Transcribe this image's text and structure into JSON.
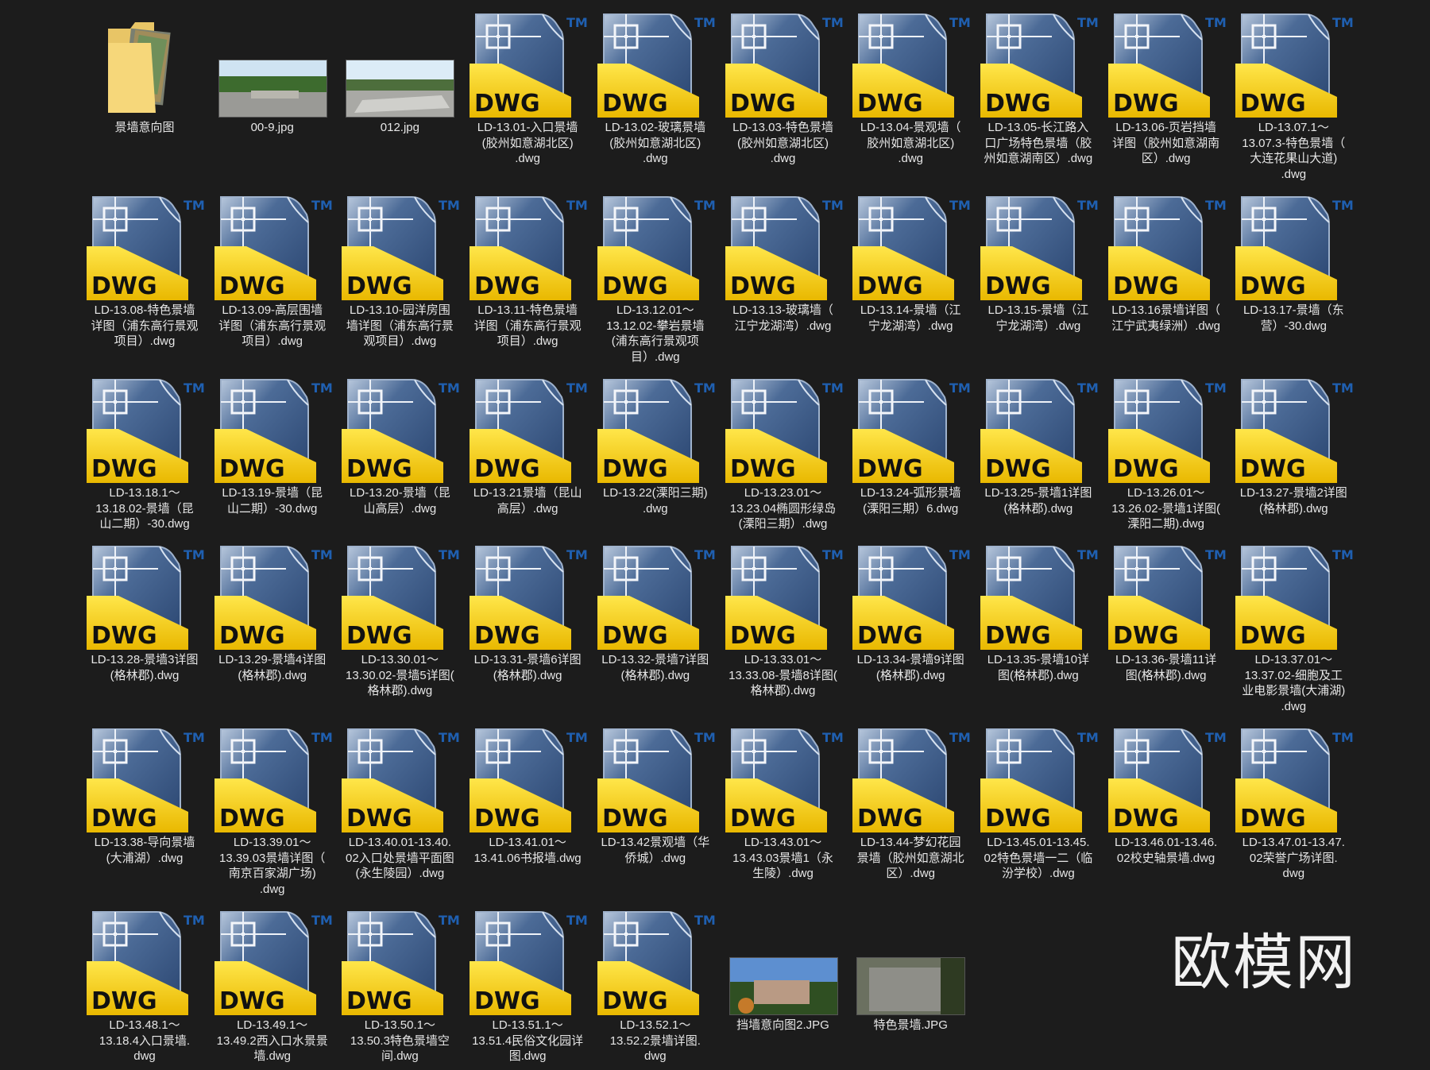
{
  "watermark": "欧模网",
  "colors": {
    "background": "#1c1c1c",
    "dwg_yellow": "#f2cf1a",
    "dwg_blue": "#3b5a86",
    "tm_blue": "#1f5fb0"
  },
  "icon_text": {
    "dwg": "DWG",
    "tm": "TM"
  },
  "items": [
    {
      "type": "folder",
      "name": "景墙意向图"
    },
    {
      "type": "jpg",
      "name": "00-9.jpg",
      "variant": "park"
    },
    {
      "type": "jpg",
      "name": "012.jpg",
      "variant": "plaza"
    },
    {
      "type": "dwg",
      "name": "LD-13.01-入口景墙\n(胶州如意湖北区)\n.dwg"
    },
    {
      "type": "dwg",
      "name": "LD-13.02-玻璃景墙\n(胶州如意湖北区)\n.dwg"
    },
    {
      "type": "dwg",
      "name": "LD-13.03-特色景墙\n(胶州如意湖北区)\n.dwg"
    },
    {
      "type": "dwg",
      "name": "LD-13.04-景观墙（\n胶州如意湖北区)\n.dwg"
    },
    {
      "type": "dwg",
      "name": "LD-13.05-长江路入\n口广场特色景墙（胶\n州如意湖南区）.dwg"
    },
    {
      "type": "dwg",
      "name": "LD-13.06-页岩挡墙\n详图（胶州如意湖南\n区）.dwg"
    },
    {
      "type": "dwg",
      "name": "LD-13.07.1～\n13.07.3-特色景墙（\n大连花果山大道)\n.dwg"
    },
    {
      "type": "dwg",
      "name": "LD-13.08-特色景墙\n详图（浦东高行景观\n项目）.dwg"
    },
    {
      "type": "dwg",
      "name": "LD-13.09-高层围墙\n详图（浦东高行景观\n项目）.dwg"
    },
    {
      "type": "dwg",
      "name": "LD-13.10-园洋房围\n墙详图（浦东高行景\n观项目）.dwg"
    },
    {
      "type": "dwg",
      "name": "LD-13.11-特色景墙\n详图（浦东高行景观\n项目）.dwg"
    },
    {
      "type": "dwg",
      "name": "LD-13.12.01～\n13.12.02-攀岩景墙\n(浦东高行景观项\n目）.dwg"
    },
    {
      "type": "dwg",
      "name": "LD-13.13-玻璃墙（\n江宁龙湖湾）.dwg"
    },
    {
      "type": "dwg",
      "name": "LD-13.14-景墙（江\n宁龙湖湾）.dwg"
    },
    {
      "type": "dwg",
      "name": "LD-13.15-景墙（江\n宁龙湖湾）.dwg"
    },
    {
      "type": "dwg",
      "name": "LD-13.16景墙详图（\n江宁武夷绿洲）.dwg"
    },
    {
      "type": "dwg",
      "name": "LD-13.17-景墙（东\n营）-30.dwg"
    },
    {
      "type": "dwg",
      "name": "LD-13.18.1～\n13.18.02-景墙（昆\n山二期）-30.dwg"
    },
    {
      "type": "dwg",
      "name": "LD-13.19-景墙（昆\n山二期）-30.dwg"
    },
    {
      "type": "dwg",
      "name": "LD-13.20-景墙（昆\n山高层）.dwg"
    },
    {
      "type": "dwg",
      "name": "LD-13.21景墙（昆山\n高层）.dwg"
    },
    {
      "type": "dwg",
      "name": "LD-13.22(溧阳三期)\n.dwg"
    },
    {
      "type": "dwg",
      "name": "LD-13.23.01～\n13.23.04椭圆形绿岛\n(溧阳三期）.dwg"
    },
    {
      "type": "dwg",
      "name": "LD-13.24-弧形景墙\n(溧阳三期）6.dwg"
    },
    {
      "type": "dwg",
      "name": "LD-13.25-景墙1详图\n(格林郡).dwg"
    },
    {
      "type": "dwg",
      "name": "LD-13.26.01～\n13.26.02-景墙1详图(\n溧阳二期).dwg"
    },
    {
      "type": "dwg",
      "name": "LD-13.27-景墙2详图\n(格林郡).dwg"
    },
    {
      "type": "dwg",
      "name": "LD-13.28-景墙3详图\n(格林郡).dwg"
    },
    {
      "type": "dwg",
      "name": "LD-13.29-景墙4详图\n(格林郡).dwg"
    },
    {
      "type": "dwg",
      "name": "LD-13.30.01～\n13.30.02-景墙5详图(\n格林郡).dwg"
    },
    {
      "type": "dwg",
      "name": "LD-13.31-景墙6详图\n(格林郡).dwg"
    },
    {
      "type": "dwg",
      "name": "LD-13.32-景墙7详图\n(格林郡).dwg"
    },
    {
      "type": "dwg",
      "name": "LD-13.33.01～\n13.33.08-景墙8详图(\n格林郡).dwg"
    },
    {
      "type": "dwg",
      "name": "LD-13.34-景墙9详图\n(格林郡).dwg"
    },
    {
      "type": "dwg",
      "name": "LD-13.35-景墙10详\n图(格林郡).dwg"
    },
    {
      "type": "dwg",
      "name": "LD-13.36-景墙11详\n图(格林郡).dwg"
    },
    {
      "type": "dwg",
      "name": "LD-13.37.01～\n13.37.02-细胞及工\n业电影景墙(大浦湖)\n.dwg"
    },
    {
      "type": "dwg",
      "name": "LD-13.38-导向景墙\n(大浦湖）.dwg"
    },
    {
      "type": "dwg",
      "name": "LD-13.39.01～\n13.39.03景墙详图（\n南京百家湖广场)\n.dwg"
    },
    {
      "type": "dwg",
      "name": "LD-13.40.01-13.40.\n02入口处景墙平面图\n(永生陵园）.dwg"
    },
    {
      "type": "dwg",
      "name": "LD-13.41.01～\n13.41.06书报墙.dwg"
    },
    {
      "type": "dwg",
      "name": "LD-13.42景观墙（华\n侨城）.dwg"
    },
    {
      "type": "dwg",
      "name": "LD-13.43.01～\n13.43.03景墙1（永\n生陵）.dwg"
    },
    {
      "type": "dwg",
      "name": "LD-13.44-梦幻花园\n景墙（胶州如意湖北\n区）.dwg"
    },
    {
      "type": "dwg",
      "name": "LD-13.45.01-13.45.\n02特色景墙一二（临\n汾学校）.dwg"
    },
    {
      "type": "dwg",
      "name": "LD-13.46.01-13.46.\n02校史轴景墙.dwg"
    },
    {
      "type": "dwg",
      "name": "LD-13.47.01-13.47.\n02荣誉广场详图.\ndwg"
    },
    {
      "type": "dwg",
      "name": "LD-13.48.1～\n13.18.4入口景墙.\ndwg"
    },
    {
      "type": "dwg",
      "name": "LD-13.49.1～\n13.49.2西入口水景景\n墙.dwg"
    },
    {
      "type": "dwg",
      "name": "LD-13.50.1～\n13.50.3特色景墙空\n间.dwg"
    },
    {
      "type": "dwg",
      "name": "LD-13.51.1～\n13.51.4民俗文化园详\n图.dwg"
    },
    {
      "type": "dwg",
      "name": "LD-13.52.1～\n13.52.2景墙详图.\ndwg"
    },
    {
      "type": "jpg",
      "name": "挡墙意向图2.JPG",
      "variant": "rock"
    },
    {
      "type": "jpg",
      "name": "特色景墙.JPG",
      "variant": "gabion"
    }
  ]
}
